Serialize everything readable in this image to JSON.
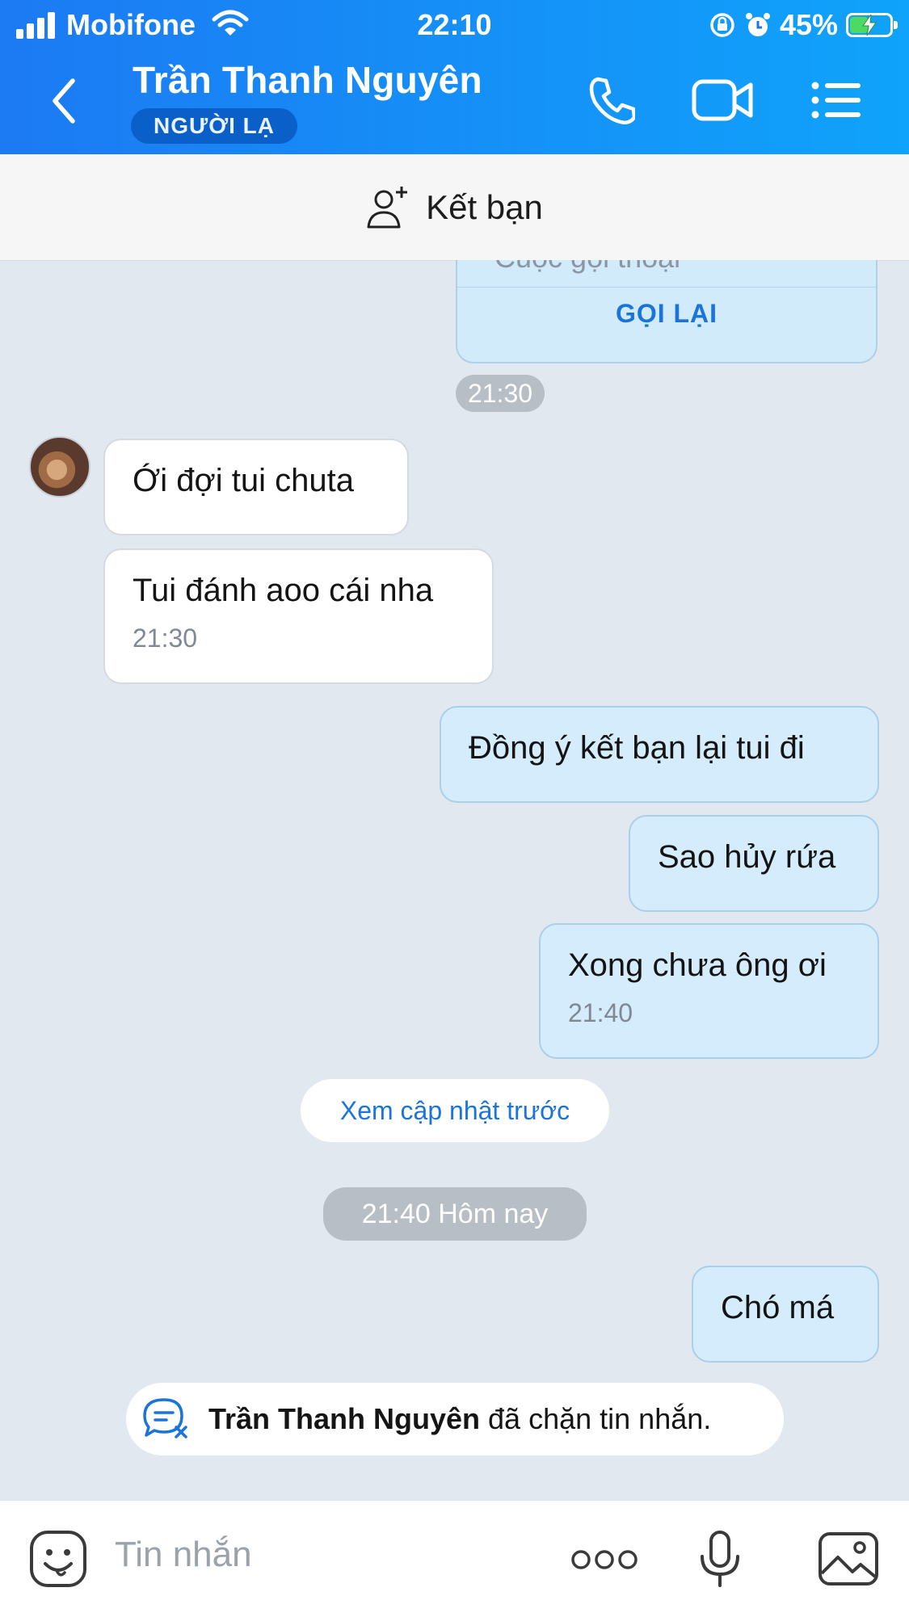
{
  "status_bar": {
    "carrier": "Mobifone",
    "time": "22:10",
    "battery_percent": "45%",
    "battery_level": 0.45,
    "icons": [
      "signal-icon",
      "wifi-icon",
      "rotation-lock-icon",
      "alarm-icon",
      "battery-charging-icon"
    ]
  },
  "header": {
    "contact_name": "Trần Thanh Nguyên",
    "badge": "NGƯỜI LẠ",
    "icons": [
      "back-icon",
      "phone-icon",
      "video-call-icon",
      "menu-list-icon"
    ],
    "accent_color": "#1c7af3"
  },
  "add_friend": {
    "label": "Kết bạn",
    "icon": "add-friend-icon"
  },
  "call_card": {
    "title": "Cuộc gọi thoại",
    "callback_label": "GỌI LẠI"
  },
  "messages": {
    "time_pill_1": "21:30",
    "m1": "Ới đợi tui chuta",
    "m2": "Tui đánh aoo cái nha",
    "m2_time": "21:30",
    "m3": "Đồng ý kết bạn lại tui đi",
    "m4": "Sao hủy rứa",
    "m5": "Xong chưa ông ơi",
    "m5_time": "21:40",
    "view_previous": "Xem cập nhật trước",
    "date_pill": "21:40 Hôm nay",
    "m6": "Chó má"
  },
  "blocked_notice": {
    "name": "Trần Thanh Nguyên",
    "text": " đã chặn tin nhắn."
  },
  "composer": {
    "placeholder": "Tin nhắn",
    "icons": [
      "emoji-icon",
      "more-icon",
      "microphone-icon",
      "image-icon"
    ]
  }
}
